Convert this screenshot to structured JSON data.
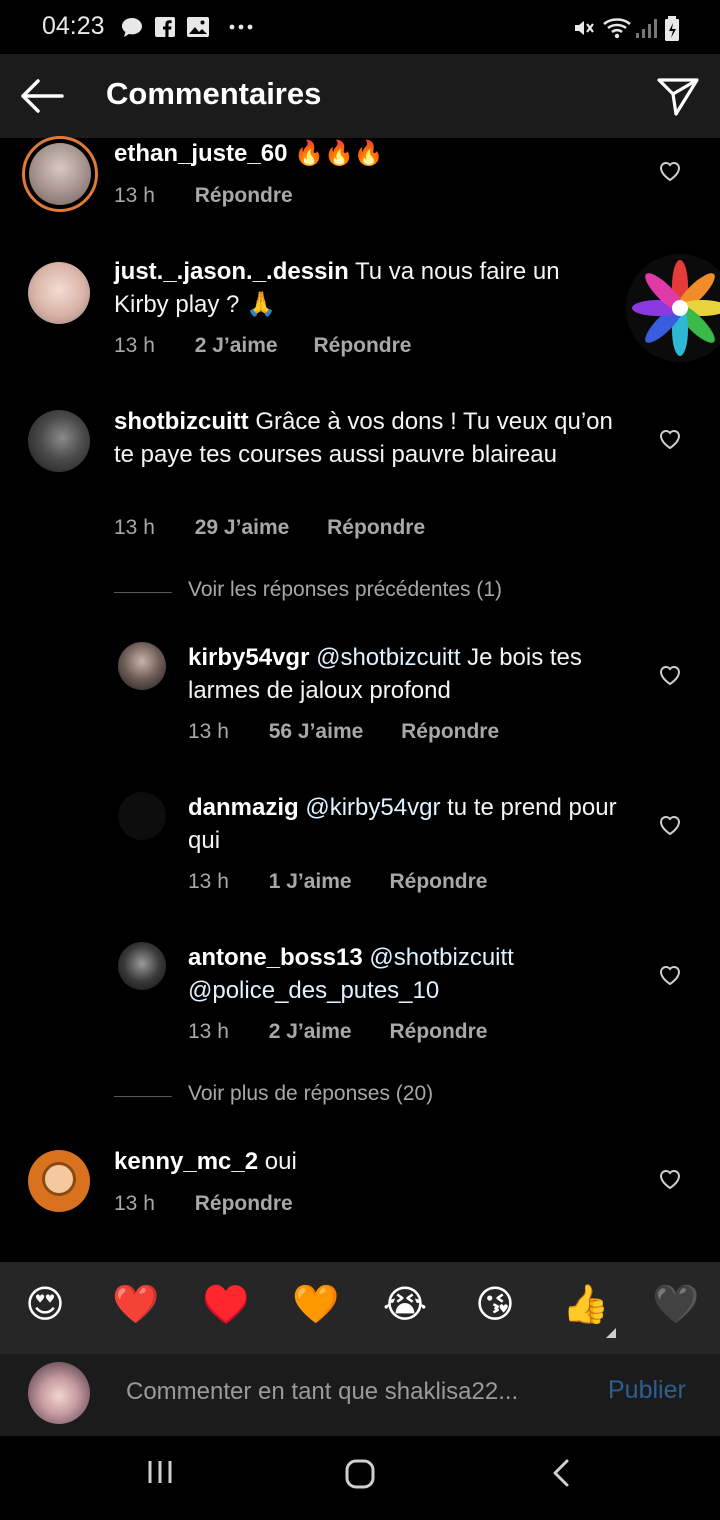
{
  "status_bar": {
    "time": "04:23",
    "icons": [
      "chat-bubble-icon",
      "facebook-icon",
      "image-icon",
      "more-dots-icon",
      "mute-icon",
      "wifi-icon",
      "signal-icon",
      "battery-icon"
    ]
  },
  "header": {
    "title": "Commentaires",
    "back_icon": "arrow-left-icon",
    "share_icon": "paper-plane-icon"
  },
  "comments": [
    {
      "user": "ethan_juste_60",
      "text": "🔥🔥🔥",
      "time": "13 h",
      "likes": "",
      "reply": "Répondre"
    },
    {
      "user": "just._.jason._.dessin",
      "text": "Tu va nous faire un Kirby play ? 🙏",
      "time": "13 h",
      "likes": "2 J’aime",
      "reply": "Répondre"
    },
    {
      "user": "shotbizcuitt",
      "text": "Grâce à vos dons ! Tu veux qu’on te paye tes courses aussi pauvre blaireau",
      "time": "13 h",
      "likes": "29 J’aime",
      "reply": "Répondre"
    }
  ],
  "view_previous": "Voir les réponses précédentes (1)",
  "replies": [
    {
      "user": "kirby54vgr",
      "mention": "@shotbizcuitt",
      "text": "Je bois tes larmes de jaloux profond",
      "time": "13 h",
      "likes": "56 J’aime",
      "reply": "Répondre"
    },
    {
      "user": "danmazig",
      "mention": "@kirby54vgr",
      "text": "tu te prend pour qui",
      "time": "13 h",
      "likes": "1 J’aime",
      "reply": "Répondre"
    },
    {
      "user": "antone_boss13",
      "mention": "@shotbizcuitt",
      "mention2": "@police_des_putes_10",
      "time": "13 h",
      "likes": "2 J’aime",
      "reply": "Répondre"
    }
  ],
  "view_more": "Voir plus de réponses (20)",
  "last_comment": {
    "user": "kenny_mc_2",
    "text": "oui",
    "time": "13 h",
    "reply": "Répondre"
  },
  "emoji_bar": [
    "😍",
    "❤️",
    "♥️",
    "🧡",
    "😭",
    "😘",
    "👍",
    "🖤"
  ],
  "input": {
    "placeholder": "Commenter en tant que shaklisa22...",
    "post_label": "Publier"
  },
  "navbar": {
    "icons": [
      "recent-apps-icon",
      "home-icon",
      "back-icon"
    ]
  },
  "colors": {
    "background": "#000000",
    "header": "#1b1b1b",
    "meta_text": "#a8a8a8",
    "post_button": "#2d5f8f"
  }
}
